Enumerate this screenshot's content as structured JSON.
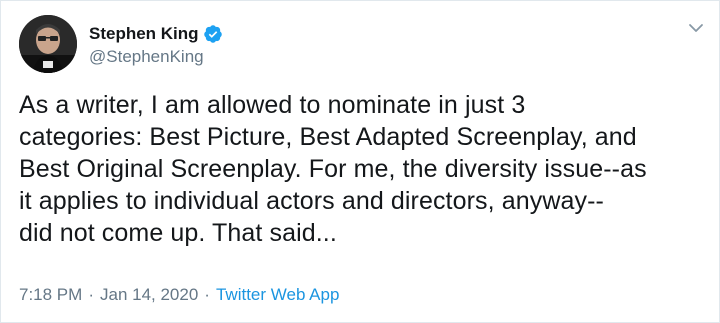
{
  "author": {
    "display_name": "Stephen King",
    "handle": "@StephenKing",
    "verified": true
  },
  "tweet": {
    "lines": [
      "As a writer, I am allowed to nominate in just 3",
      "categories: Best Picture, Best Adapted Screenplay, and",
      "Best Original Screenplay. For me, the diversity issue--as",
      "it applies to individual actors and directors, anyway--",
      "did not come up. That said..."
    ],
    "time": "7:18 PM",
    "date": "Jan 14, 2020",
    "separator": "·",
    "source": "Twitter Web App"
  },
  "icons": {
    "verified": "verified-badge-icon",
    "menu": "chevron-down-icon"
  },
  "colors": {
    "text": "#14171a",
    "muted": "#657786",
    "accent": "#1da1f2",
    "link": "#1b95e0",
    "border": "#e1e8ed"
  }
}
